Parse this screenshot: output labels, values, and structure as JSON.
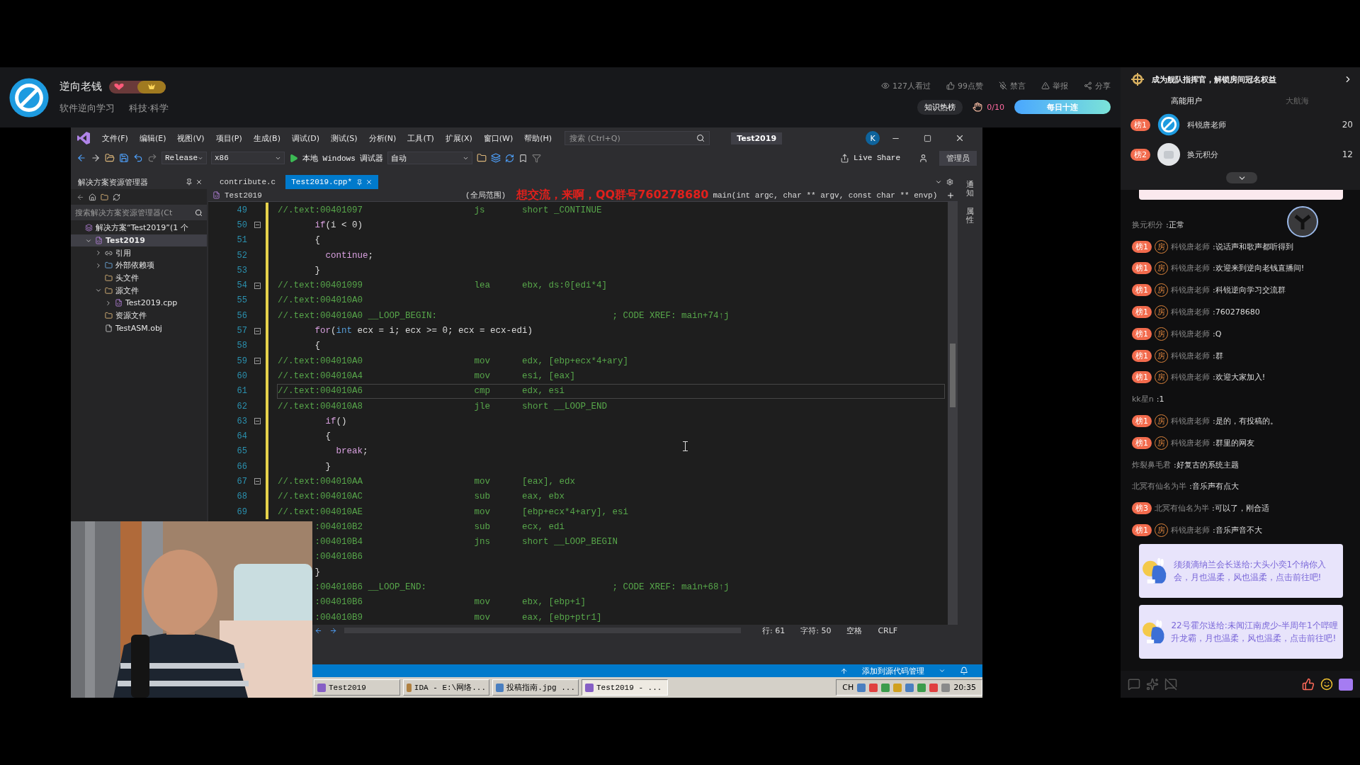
{
  "header": {
    "streamer": "逆向老钱",
    "tags": [
      "软件逆向学习",
      "科技·科学"
    ],
    "stats": [
      {
        "kind": "views",
        "text": "127人看过"
      },
      {
        "kind": "likes",
        "text": "99点赞"
      },
      {
        "kind": "mute",
        "text": "禁言"
      },
      {
        "kind": "report",
        "text": "举报"
      },
      {
        "kind": "share",
        "text": "分享"
      }
    ],
    "hot_rank": "知识热榜",
    "task_progress": "0/10",
    "daily_button": "每日十连"
  },
  "ide": {
    "menu": [
      "文件(F)",
      "编辑(E)",
      "视图(V)",
      "项目(P)",
      "生成(B)",
      "调试(D)",
      "测试(S)",
      "分析(N)",
      "工具(T)",
      "扩展(X)",
      "窗口(W)",
      "帮助(H)"
    ],
    "search_placeholder": "搜索 (Ctrl+Q)",
    "solution_name": "Test2019",
    "user_initial": "K",
    "toolbar": {
      "config": "Release",
      "platform": "x86",
      "debugger": "本地 Windows 调试器",
      "mode": "自动",
      "live_share": "Live Share",
      "admin": "管理员"
    },
    "solution_explorer": {
      "title": "解决方案资源管理器",
      "search_placeholder": "搜索解决方案资源管理器(Ct",
      "tree": [
        {
          "label": "解决方案“Test2019”(1 个",
          "kind": "solution",
          "selected": false,
          "children": [
            {
              "label": "Test2019",
              "kind": "project",
              "selected": true,
              "expanded": true,
              "children": [
                {
                  "label": "引用",
                  "kind": "refs",
                  "selected": false,
                  "expanded": false
                },
                {
                  "label": "外部依赖项",
                  "kind": "deps",
                  "selected": false,
                  "expanded": false
                },
                {
                  "label": "头文件",
                  "kind": "folder",
                  "selected": false
                },
                {
                  "label": "源文件",
                  "kind": "folder",
                  "selected": false,
                  "expanded": true,
                  "children": [
                    {
                      "label": "Test2019.cpp",
                      "kind": "cpp",
                      "selected": false,
                      "expanded": false
                    }
                  ]
                },
                {
                  "label": "资源文件",
                  "kind": "folder",
                  "selected": false
                },
                {
                  "label": "TestASM.obj",
                  "kind": "obj",
                  "selected": false
                }
              ]
            }
          ]
        }
      ]
    },
    "editor": {
      "tabs": [
        {
          "label": "contribute.c",
          "selected": false
        },
        {
          "label": "Test2019.cpp*",
          "selected": true
        }
      ],
      "project": "Test2019",
      "scope": "(全局范围)",
      "overlay_text": "想交流，来啊，QQ群号760278680",
      "function": "main(int argc, char ** argv, const char ** envp)",
      "lines": [
        {
          "num": "49",
          "kind": "asm",
          "addr": "//.text:00401097",
          "op": "js",
          "arg": "short _CONTINUE",
          "fold": false,
          "current": false,
          "clipped": false
        },
        {
          "num": "50",
          "kind": "c",
          "segs": [
            {
              "kind": "control",
              "t": "       if"
            },
            {
              "kind": "plain",
              "t": "(i < 0)"
            }
          ],
          "fold": true,
          "current": false,
          "clipped": false
        },
        {
          "num": "51",
          "kind": "c",
          "segs": [
            {
              "kind": "plain",
              "t": "       {"
            }
          ],
          "fold": false,
          "current": false,
          "clipped": false
        },
        {
          "num": "52",
          "kind": "c",
          "segs": [
            {
              "kind": "control",
              "t": "         continue"
            },
            {
              "kind": "plain",
              "t": ";"
            }
          ],
          "fold": false,
          "current": false,
          "clipped": false
        },
        {
          "num": "53",
          "kind": "c",
          "segs": [
            {
              "kind": "plain",
              "t": "       }"
            }
          ],
          "fold": false,
          "current": false,
          "clipped": false
        },
        {
          "num": "54",
          "kind": "asm",
          "addr": "//.text:00401099",
          "op": "lea",
          "arg": "ebx, ds:0[edi*4]",
          "fold": true,
          "current": false,
          "clipped": false
        },
        {
          "num": "55",
          "kind": "addr",
          "addr": "//.text:004010A0",
          "fold": false,
          "current": false,
          "clipped": false
        },
        {
          "num": "56",
          "kind": "label",
          "addr": "//.text:004010A0",
          "label": "__LOOP_BEGIN:",
          "xref": "; CODE XREF: main+74↑j",
          "fold": false,
          "current": false,
          "clipped": false
        },
        {
          "num": "57",
          "kind": "c",
          "segs": [
            {
              "kind": "control",
              "t": "       for"
            },
            {
              "kind": "plain",
              "t": "("
            },
            {
              "kind": "keyword",
              "t": "int"
            },
            {
              "kind": "plain",
              "t": " ecx = i; ecx >= 0; ecx = ecx-edi)"
            }
          ],
          "fold": true,
          "current": false,
          "clipped": false
        },
        {
          "num": "58",
          "kind": "c",
          "segs": [
            {
              "kind": "plain",
              "t": "       {"
            }
          ],
          "fold": false,
          "current": false,
          "clipped": false
        },
        {
          "num": "59",
          "kind": "asm",
          "addr": "//.text:004010A0",
          "op": "mov",
          "arg": "edx, [ebp+ecx*4+ary]",
          "fold": true,
          "current": false,
          "clipped": false
        },
        {
          "num": "60",
          "kind": "asm",
          "addr": "//.text:004010A4",
          "op": "mov",
          "arg": "esi, [eax]",
          "fold": false,
          "current": false,
          "clipped": false
        },
        {
          "num": "61",
          "kind": "asm",
          "addr": "//.text:004010A6",
          "op": "cmp",
          "arg": "edx, esi",
          "fold": false,
          "current": true,
          "clipped": false
        },
        {
          "num": "62",
          "kind": "asm",
          "addr": "//.text:004010A8",
          "op": "jle",
          "arg": "short __LOOP_END",
          "fold": false,
          "current": false,
          "clipped": false
        },
        {
          "num": "63",
          "kind": "c",
          "segs": [
            {
              "kind": "control",
              "t": "         if"
            },
            {
              "kind": "plain",
              "t": "()"
            }
          ],
          "fold": true,
          "current": false,
          "clipped": false
        },
        {
          "num": "64",
          "kind": "c",
          "segs": [
            {
              "kind": "plain",
              "t": "         {"
            }
          ],
          "fold": false,
          "current": false,
          "clipped": false
        },
        {
          "num": "65",
          "kind": "c",
          "segs": [
            {
              "kind": "control",
              "t": "           break"
            },
            {
              "kind": "plain",
              "t": ";"
            }
          ],
          "fold": false,
          "current": false,
          "clipped": false
        },
        {
          "num": "66",
          "kind": "c",
          "segs": [
            {
              "kind": "plain",
              "t": "         }"
            }
          ],
          "fold": false,
          "current": false,
          "clipped": false
        },
        {
          "num": "67",
          "kind": "asm",
          "addr": "//.text:004010AA",
          "op": "mov",
          "arg": "[eax], edx",
          "fold": true,
          "current": false,
          "clipped": false
        },
        {
          "num": "68",
          "kind": "asm",
          "addr": "//.text:004010AC",
          "op": "sub",
          "arg": "eax, ebx",
          "fold": false,
          "current": false,
          "clipped": false
        },
        {
          "num": "69",
          "kind": "asm",
          "addr": "//.text:004010AE",
          "op": "mov",
          "arg": "[ebp+ecx*4+ary], esi",
          "fold": false,
          "current": false,
          "clipped": false
        },
        {
          "kind": "asm",
          "addr": ":004010B2",
          "op": "sub",
          "arg": "ecx, edi",
          "fold": false,
          "current": false,
          "clipped": true
        },
        {
          "kind": "asm",
          "addr": ":004010B4",
          "op": "jns",
          "arg": "short __LOOP_BEGIN",
          "fold": false,
          "current": false,
          "clipped": true
        },
        {
          "kind": "addr",
          "addr": ":004010B6",
          "fold": false,
          "current": false,
          "clipped": true
        },
        {
          "kind": "c",
          "segs": [
            {
              "kind": "plain",
              "t": "}"
            }
          ],
          "fold": false,
          "current": false,
          "clipped": true
        },
        {
          "kind": "label",
          "addr": ":004010B6",
          "label": "__LOOP_END:",
          "xref": "; CODE XREF: main+68↑j",
          "fold": false,
          "current": false,
          "clipped": true
        },
        {
          "kind": "asm",
          "addr": ":004010B6",
          "op": "mov",
          "arg": "ebx, [ebp+i]",
          "fold": false,
          "current": false,
          "clipped": true
        },
        {
          "kind": "asm",
          "addr": ":004010B9",
          "op": "mov",
          "arg": "eax, [ebp+ptr1]",
          "fold": false,
          "current": false,
          "clipped": true
        }
      ],
      "status": {
        "line": "行: 61",
        "col": "字符: 50",
        "spaces": "空格",
        "eol": "CRLF"
      }
    },
    "side_rail": [
      "通知",
      "属性"
    ],
    "status_bar": {
      "source_control": "添加到源代码管理"
    },
    "taskbar": {
      "buttons": [
        {
          "label": "Test2019",
          "kind": "vs",
          "selected": false
        },
        {
          "label": "IDA - E:\\网络...",
          "kind": "ida",
          "selected": false
        },
        {
          "label": "投稿指南.jpg ...",
          "selected": false
        },
        {
          "label": "Test2019 - ...",
          "kind": "vs",
          "selected": true
        }
      ],
      "lang": "CH",
      "time": "20:35"
    }
  },
  "sidebar": {
    "fleet_banner": "成为舰队指挥官，解锁房间冠名权益",
    "tabs": [
      {
        "label": "高能用户",
        "selected": true
      },
      {
        "label": "大航海",
        "selected": false
      }
    ],
    "ranking": [
      {
        "rank": "榜1",
        "name": "科锐唐老师",
        "score": "20",
        "kind": "logo"
      },
      {
        "rank": "榜2",
        "name": "换元积分",
        "score": "12",
        "kind": "default"
      }
    ],
    "messages": [
      {
        "user": "换元积分",
        "text": ":正常"
      },
      {
        "rank": "榜1",
        "room": "房",
        "user": "科锐唐老师",
        "text": ":说话声和歌声都听得到"
      },
      {
        "rank": "榜1",
        "room": "房",
        "user": "科锐唐老师",
        "text": ":欢迎来到逆向老钱直播间!"
      },
      {
        "rank": "榜1",
        "room": "房",
        "user": "科锐唐老师",
        "text": ":科锐逆向学习交流群"
      },
      {
        "rank": "榜1",
        "room": "房",
        "user": "科锐唐老师",
        "text": ":760278680"
      },
      {
        "rank": "榜1",
        "room": "房",
        "user": "科锐唐老师",
        "text": ":Q"
      },
      {
        "rank": "榜1",
        "room": "房",
        "user": "科锐唐老师",
        "text": ":群"
      },
      {
        "rank": "榜1",
        "room": "房",
        "user": "科锐唐老师",
        "text": ":欢迎大家加入!"
      },
      {
        "user": "kk星n",
        "text": ":1"
      },
      {
        "rank": "榜1",
        "room": "房",
        "user": "科锐唐老师",
        "text": ":是的，有投稿的。"
      },
      {
        "rank": "榜1",
        "room": "房",
        "user": "科锐唐老师",
        "text": ":群里的网友"
      },
      {
        "user": "炸裂鼻毛君",
        "text": ":好复古的系统主题"
      },
      {
        "user": "北冥有仙名为半",
        "text": ":音乐声有点大"
      },
      {
        "rank": "榜3",
        "user": "北冥有仙名为半",
        "text": ":可以了，刚合适"
      },
      {
        "rank": "榜1",
        "room": "房",
        "user": "科锐唐老师",
        "text": ":音乐声音不大"
      }
    ],
    "gifts": [
      {
        "text": "须须滴纳兰会长送给:大头小奕1个纳你入会，月也温柔，风也温柔，点击前往吧!"
      },
      {
        "text": "22号霍尔送给:未闻江南虎少-半周年1个哔哩升龙霸，月也温柔，风也温柔，点击前往吧!"
      }
    ]
  }
}
